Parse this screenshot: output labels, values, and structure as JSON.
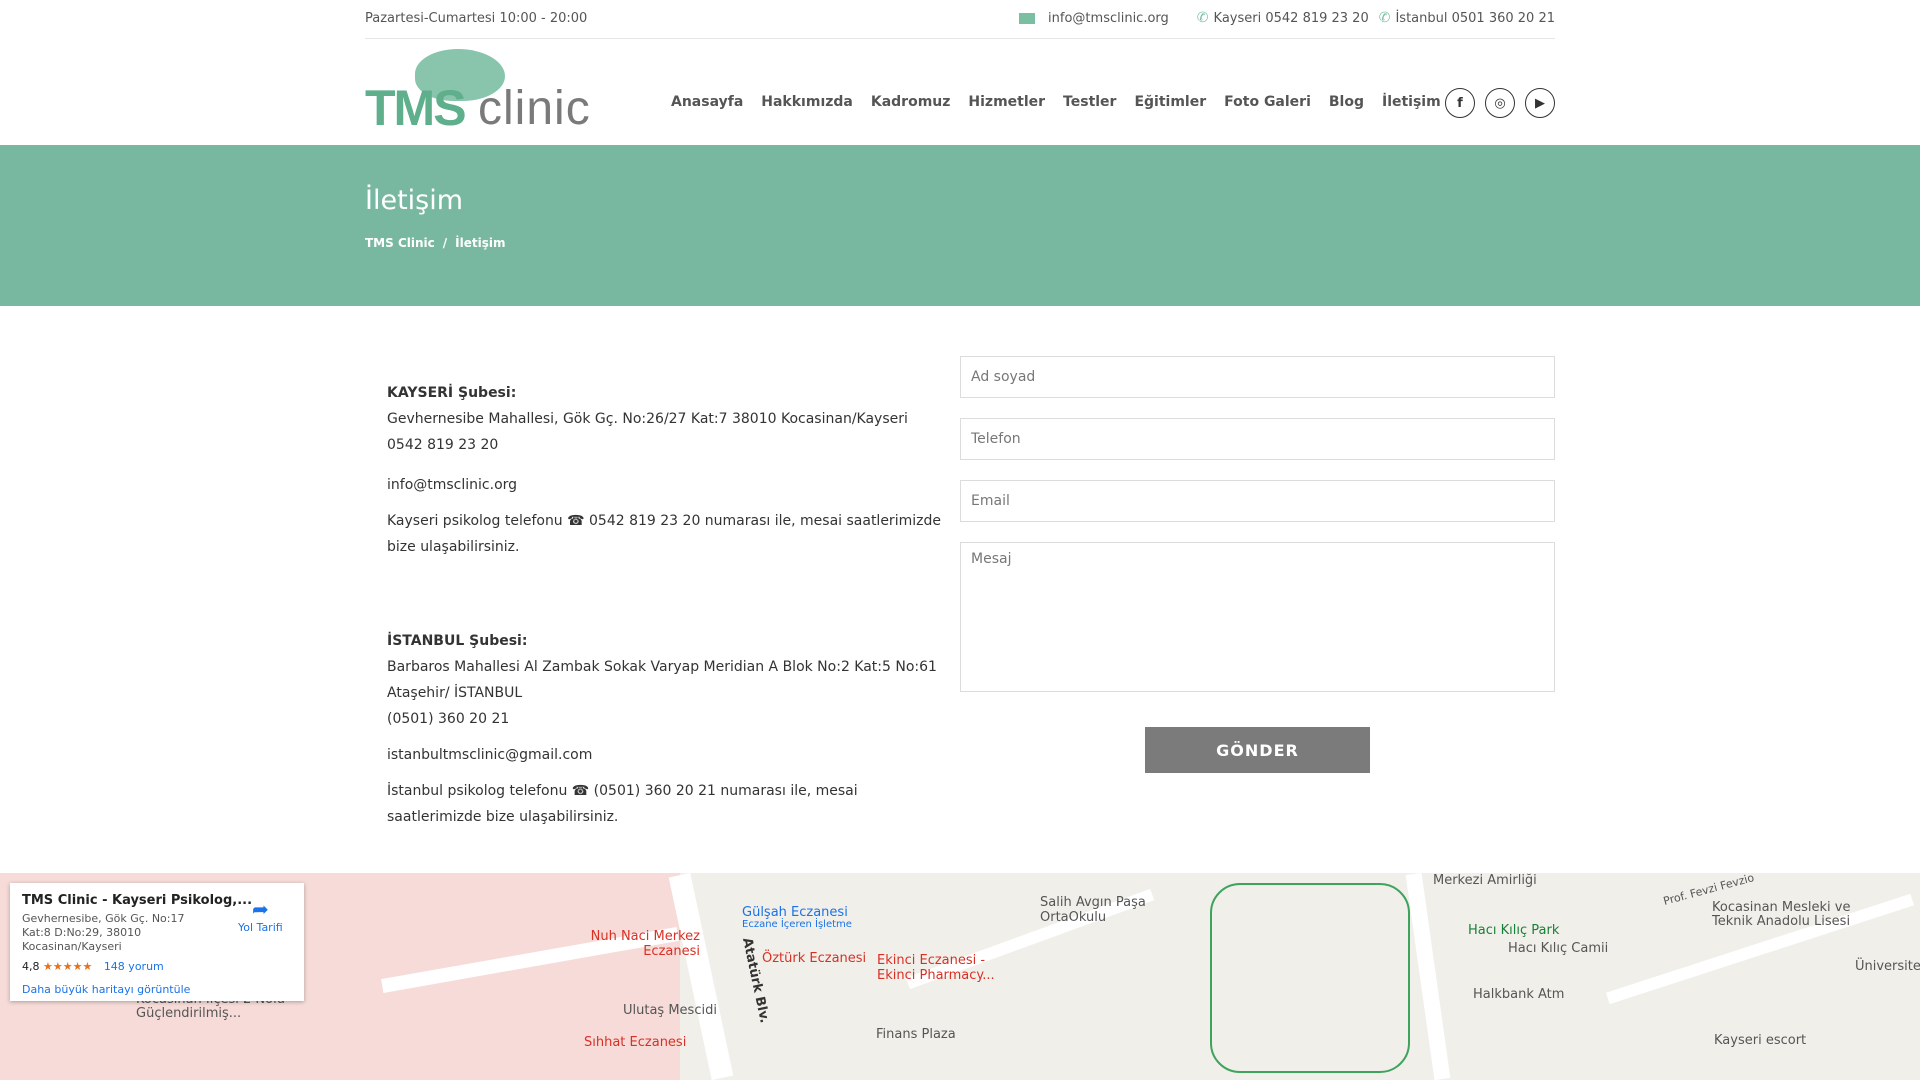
{
  "topbar": {
    "hours": "Pazartesi-Cumartesi 10:00 - 20:00",
    "email": "info@tmsclinic.org",
    "phone_kayseri": "Kayseri 0542 819 23 20",
    "phone_istanbul": "İstanbul 0501 360 20 21"
  },
  "logo": {
    "tms": "TMS",
    "clinic": "clinic"
  },
  "nav": [
    "Anasayfa",
    "Hakkımızda",
    "Kadromuz",
    "Hizmetler",
    "Testler",
    "Eğitimler",
    "Foto Galeri",
    "Blog",
    "İletişim"
  ],
  "social": {
    "facebook": "f",
    "instagram": "◎",
    "youtube": "▶"
  },
  "banner": {
    "title": "İletişim",
    "crumb_home": "TMS Clinic",
    "crumb_sep": "/",
    "crumb_current": "İletişim"
  },
  "info": {
    "kayseri": {
      "title": "KAYSERİ Şubesi:",
      "address": "Gevhernesibe Mahallesi, Gök Gç. No:26/27 Kat:7 38010 Kocasinan/Kayseri",
      "phone": "0542 819 23 20",
      "email": "info@tmsclinic.org",
      "note_line1": "Kayseri psikolog telefonu ☎ 0542 819 23 20 numarası ile, mesai saatlerimizde",
      "note_line2": "bize ulaşabilirsiniz."
    },
    "istanbul": {
      "title": "İSTANBUL Şubesi:",
      "address_line1": "Barbaros Mahallesi Al Zambak Sokak Varyap Meridian A Blok No:2 Kat:5 No:61",
      "address_line2": "Ataşehir/ İSTANBUL",
      "phone": "(0501) 360 20 21",
      "email": "istanbultmsclinic@gmail.com",
      "note_line1": "İstanbul psikolog telefonu ☎ (0501) 360 20 21 numarası ile, mesai",
      "note_line2": "saatlerimizde bize ulaşabilirsiniz."
    }
  },
  "form": {
    "name_placeholder": "Ad soyad",
    "phone_placeholder": "Telefon",
    "email_placeholder": "Email",
    "message_placeholder": "Mesaj",
    "submit": "GÖNDER"
  },
  "map": {
    "card_title": "TMS Clinic - Kayseri Psikolog,...",
    "card_address": "Gevhernesibe, Gök Gç. No:17 Kat:8 D:No:29, 38010 Kocasinan/Kayseri",
    "rating": "4,8",
    "stars": "★★★★★",
    "reviews": "148 yorum",
    "bigger_map": "Daha büyük haritayı görüntüle",
    "directions": "Yol Tarifi",
    "pois": {
      "gulsah": "Gülşah Eczanesi",
      "gulsah_sub": "Eczane İçeren İşletme",
      "nuh": "Nuh Naci Merkez Eczanesi",
      "ozturk": "Öztürk Eczanesi",
      "ekinci": "Ekinci Eczanesi - Ekinci Pharmacy...",
      "ulutas": "Ulutaş Mescidi",
      "sihhat": "Sıhhat Eczanesi",
      "ataturk": "Atatürk Blv.",
      "salih": "Salih Avgın Paşa OrtaOkulu",
      "finans": "Finans Plaza",
      "merkezi": "Merkezi Amirliği",
      "haci_park": "Hacı Kılıç Park",
      "haci_camii": "Hacı Kılıç Camii",
      "halkbank": "Halkbank Atm",
      "kocasinan_lise": "Kocasinan Mesleki ve Teknik Anadolu Lisesi",
      "universite": "Üniversite",
      "escort": "Kayseri escort",
      "fevzi": "Prof. Fevzi Fevzio",
      "kocasinan_ilce": "Kocasinan İlçesi 2 Nolu Güçlendirilmiş..."
    }
  }
}
